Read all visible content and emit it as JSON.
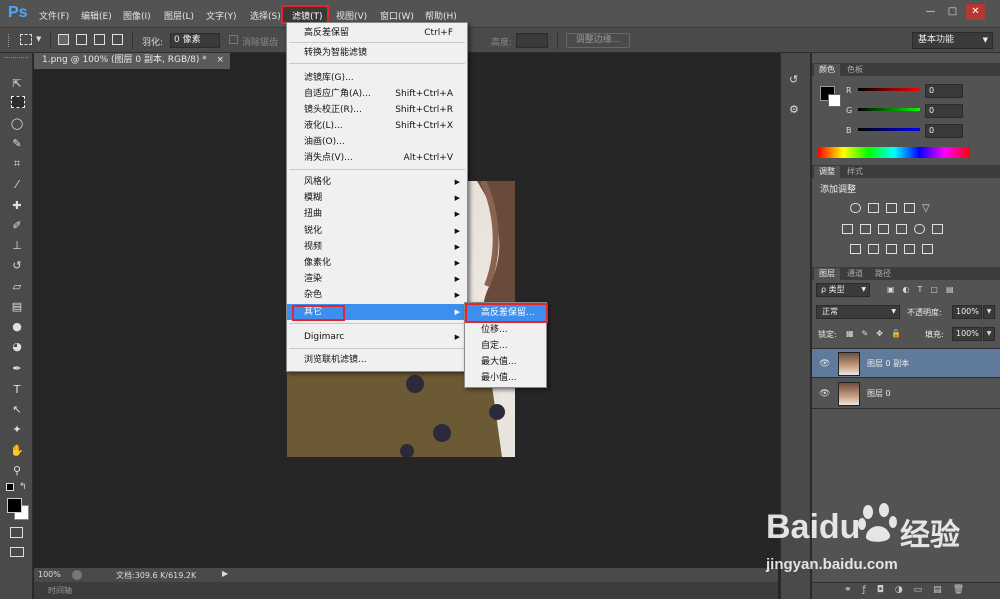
{
  "app": {
    "logo": "Ps"
  },
  "menubar": {
    "items": [
      "文件(F)",
      "编辑(E)",
      "图像(I)",
      "图层(L)",
      "文字(Y)",
      "选择(S)",
      "滤镜(T)",
      "视图(V)",
      "窗口(W)",
      "帮助(H)"
    ],
    "active_index": 6
  },
  "window_controls": {
    "minimize": "—",
    "maximize": "□",
    "close": "✕"
  },
  "options_bar": {
    "feather_label": "羽化:",
    "feather_value": "0 像素",
    "antialias_label": "消除锯齿",
    "height_label": "高度:",
    "refine_edge_label": "调整边缘...",
    "workspace": "基本功能"
  },
  "document": {
    "tab_title": "1.png @ 100% (图层 0 副本, RGB/8) *",
    "close": "×",
    "zoom": "100%",
    "doc_info": "文档:309.6 K/619.2K"
  },
  "timeline": {
    "label": "时间轴"
  },
  "filter_menu": {
    "items": [
      {
        "label": "高反差保留",
        "shortcut": "Ctrl+F"
      },
      {
        "label": "转换为智能滤镜",
        "shortcut": ""
      },
      {
        "label": "滤镜库(G)...",
        "shortcut": ""
      },
      {
        "label": "自适应广角(A)...",
        "shortcut": "Shift+Ctrl+A"
      },
      {
        "label": "镜头校正(R)...",
        "shortcut": "Shift+Ctrl+R"
      },
      {
        "label": "液化(L)...",
        "shortcut": "Shift+Ctrl+X"
      },
      {
        "label": "油画(O)...",
        "shortcut": ""
      },
      {
        "label": "消失点(V)...",
        "shortcut": "Alt+Ctrl+V"
      },
      {
        "label": "风格化",
        "shortcut": ""
      },
      {
        "label": "模糊",
        "shortcut": ""
      },
      {
        "label": "扭曲",
        "shortcut": ""
      },
      {
        "label": "锐化",
        "shortcut": ""
      },
      {
        "label": "视频",
        "shortcut": ""
      },
      {
        "label": "像素化",
        "shortcut": ""
      },
      {
        "label": "渲染",
        "shortcut": ""
      },
      {
        "label": "杂色",
        "shortcut": ""
      },
      {
        "label": "其它",
        "shortcut": ""
      },
      {
        "label": "Digimarc",
        "shortcut": ""
      },
      {
        "label": "浏览联机滤镜...",
        "shortcut": ""
      }
    ],
    "highlighted_index": 16
  },
  "other_submenu": {
    "items": [
      "高反差保留...",
      "位移...",
      "自定...",
      "最大值...",
      "最小值..."
    ],
    "highlighted_index": 0
  },
  "color_panel": {
    "tabs": [
      "颜色",
      "色板"
    ],
    "r_label": "R",
    "g_label": "G",
    "b_label": "B",
    "r": "0",
    "g": "0",
    "b": "0"
  },
  "adjust_panel": {
    "tabs": [
      "调整",
      "样式"
    ],
    "title": "添加调整"
  },
  "layers_panel": {
    "tabs": [
      "图层",
      "通道",
      "路径"
    ],
    "kind_label": "ρ 类型",
    "blend_mode": "正常",
    "opacity_label": "不透明度:",
    "opacity": "100%",
    "lock_label": "锁定:",
    "fill_label": "填充:",
    "fill": "100%",
    "layers": [
      {
        "name": "图层 0 副本",
        "selected": true
      },
      {
        "name": "图层 0",
        "selected": false
      }
    ]
  },
  "watermark": {
    "brand": "Baidu",
    "brand_cn": "经验",
    "url": "jingyan.baidu.com"
  },
  "colors": {
    "accent": "#3d8fef",
    "highlight_border": "#e4252e",
    "ps_blue": "#4aa8ff"
  }
}
